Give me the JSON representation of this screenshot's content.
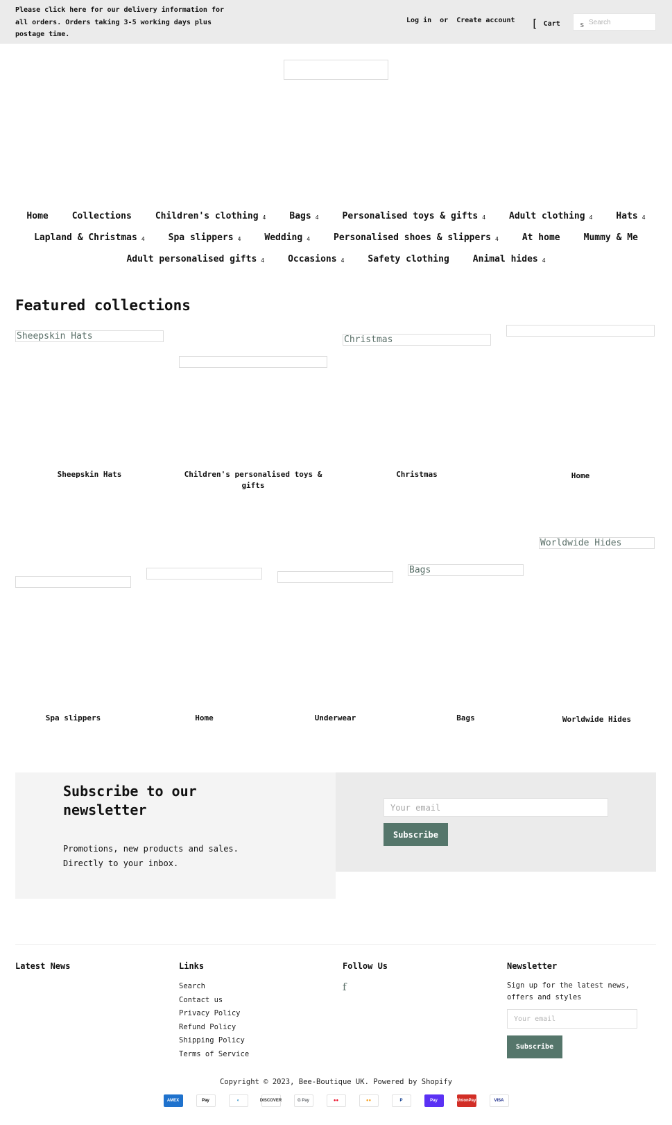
{
  "announcement": "Please click here for our delivery information for all orders. Orders taking 3-5 working days plus postage time.",
  "header": {
    "login": "Log in",
    "or": "or",
    "create_account": "Create account",
    "cart_icon": "[",
    "cart": "Cart",
    "search_icon": "s",
    "search_placeholder": "Search"
  },
  "nav": {
    "rows": [
      [
        {
          "label": "Home",
          "dropdown": false
        },
        {
          "label": "Collections",
          "dropdown": false
        },
        {
          "label": "Children's clothing",
          "dropdown": true
        },
        {
          "label": "Bags",
          "dropdown": true
        },
        {
          "label": "Personalised toys & gifts",
          "dropdown": true
        },
        {
          "label": "Adult clothing",
          "dropdown": true
        },
        {
          "label": "Hats",
          "dropdown": true
        }
      ],
      [
        {
          "label": "Lapland & Christmas",
          "dropdown": true
        },
        {
          "label": "Spa slippers",
          "dropdown": true
        },
        {
          "label": "Wedding",
          "dropdown": true
        },
        {
          "label": "Personalised shoes & slippers",
          "dropdown": true
        },
        {
          "label": "At home",
          "dropdown": false
        },
        {
          "label": "Mummy & Me",
          "dropdown": false
        }
      ],
      [
        {
          "label": "Adult personalised gifts",
          "dropdown": true
        },
        {
          "label": "Occasions",
          "dropdown": true
        },
        {
          "label": "Safety clothing",
          "dropdown": false
        },
        {
          "label": "Animal hides",
          "dropdown": true
        }
      ]
    ],
    "caret_glyph": "4"
  },
  "featured": {
    "title": "Featured collections",
    "row1": [
      {
        "alt": "Sheepskin Hats",
        "label": "Sheepskin Hats"
      },
      {
        "alt": "",
        "label": "Children's personalised toys & gifts"
      },
      {
        "alt": "Christmas",
        "label": "Christmas"
      },
      {
        "alt": "",
        "label": "Home"
      }
    ],
    "row2": [
      {
        "alt": "",
        "label": "Spa slippers"
      },
      {
        "alt": "",
        "label": "Home"
      },
      {
        "alt": "",
        "label": "Underwear"
      },
      {
        "alt": "Bags",
        "label": "Bags"
      },
      {
        "alt": "Worldwide Hides",
        "label": "Worldwide Hides"
      }
    ]
  },
  "newsletter": {
    "title": "Subscribe to our newsletter",
    "text": "Promotions, new products and sales. Directly to your inbox.",
    "email_placeholder": "Your email",
    "button": "Subscribe"
  },
  "footer": {
    "latest_news": "Latest News",
    "links_title": "Links",
    "links": [
      "Search",
      "Contact us",
      "Privacy Policy",
      "Refund Policy",
      "Shipping Policy",
      "Terms of Service"
    ],
    "follow_title": "Follow Us",
    "facebook_icon": "f",
    "newsletter_title": "Newsletter",
    "newsletter_text": "Sign up for the latest news, offers and styles",
    "email_placeholder": "Your email",
    "button": "Subscribe",
    "copyright": "Copyright © 2023, Bee-Boutique UK. Powered by Shopify",
    "payments": [
      {
        "name": "American Express",
        "text": "AMEX",
        "bg": "#1f72cd",
        "fg": "#ffffff"
      },
      {
        "name": "Apple Pay",
        "text": "Pay",
        "bg": "#ffffff",
        "fg": "#000000"
      },
      {
        "name": "Diners Club",
        "text": "◐",
        "bg": "#ffffff",
        "fg": "#0079be"
      },
      {
        "name": "Discover",
        "text": "DISCOVER",
        "bg": "#ffffff",
        "fg": "#333333"
      },
      {
        "name": "Google Pay",
        "text": "G Pay",
        "bg": "#ffffff",
        "fg": "#5f6368"
      },
      {
        "name": "Maestro",
        "text": "●●",
        "bg": "#ffffff",
        "fg": "#eb001b"
      },
      {
        "name": "Mastercard",
        "text": "●●",
        "bg": "#ffffff",
        "fg": "#f79e1b"
      },
      {
        "name": "PayPal",
        "text": "P",
        "bg": "#ffffff",
        "fg": "#003087"
      },
      {
        "name": "Shop Pay",
        "text": "Pay",
        "bg": "#5a31f4",
        "fg": "#ffffff"
      },
      {
        "name": "Union Pay",
        "text": "UnionPay",
        "bg": "#d22e26",
        "fg": "#ffffff"
      },
      {
        "name": "Visa",
        "text": "VISA",
        "bg": "#ffffff",
        "fg": "#142688"
      }
    ]
  },
  "colors": {
    "accent": "#55766b",
    "topbar_bg": "#ebebeb",
    "newsletter_left_bg": "#f4f4f4",
    "newsletter_right_bg": "#ebebeb"
  }
}
